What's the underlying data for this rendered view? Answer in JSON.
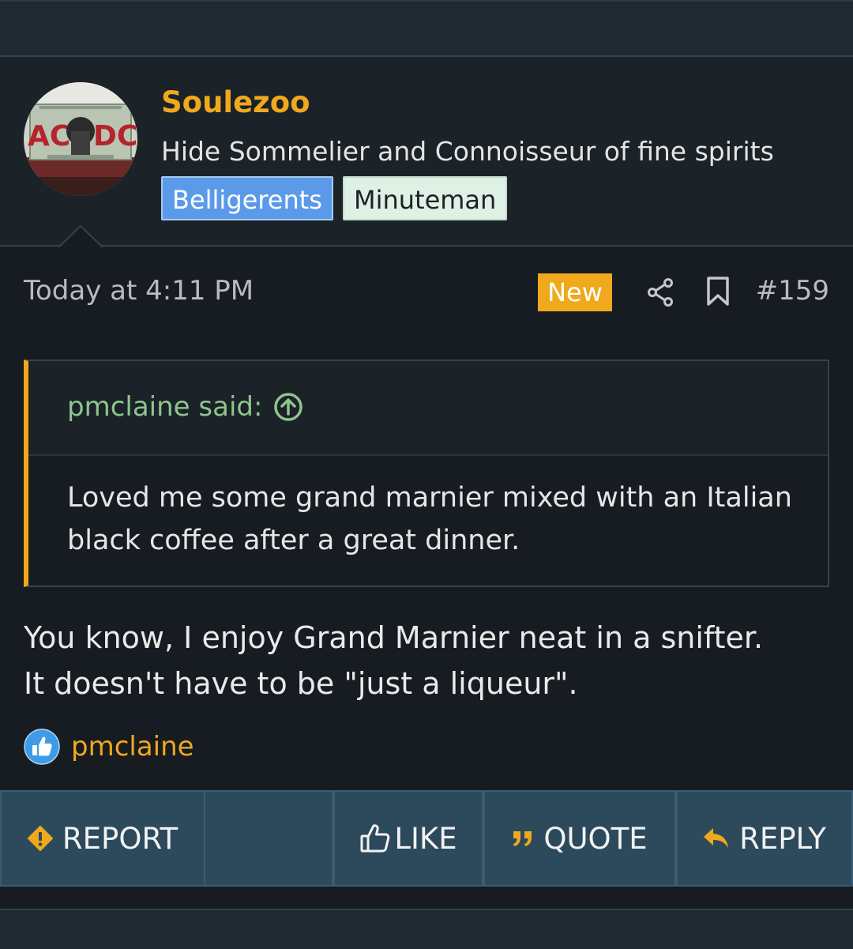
{
  "user": {
    "name": "Soulezoo",
    "title": "Hide Sommelier and Connoisseur of fine spirits",
    "badges": [
      "Belligerents",
      "Minuteman"
    ],
    "avatar_text": "AC DC"
  },
  "post": {
    "date": "Today at 4:11 PM",
    "new_label": "New",
    "number": "#159"
  },
  "quote": {
    "author": "pmclaine said:",
    "text": "Loved me some grand marnier mixed with an Italian black coffee after a great dinner."
  },
  "body": {
    "line1": "You know, I enjoy Grand Marnier neat in a snifter.",
    "line2": "It doesn't have to be \"just a liqueur\"."
  },
  "reactions": {
    "users": "pmclaine"
  },
  "actions": {
    "report": "REPORT",
    "like": "LIKE",
    "quote": "QUOTE",
    "reply": "REPLY"
  },
  "colors": {
    "accent": "#f0a81c",
    "quote_author": "#8fc48e",
    "button_bg": "#2d4a5c",
    "badge_blue": "#5b9ae8",
    "badge_mint": "#def1e4"
  }
}
